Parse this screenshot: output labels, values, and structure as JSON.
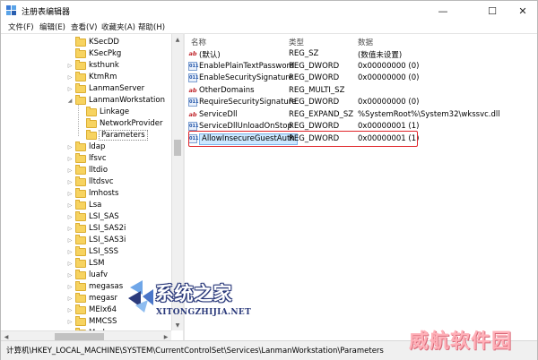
{
  "window": {
    "title": "注册表编辑器",
    "minimize_glyph": "—",
    "maximize_glyph": "☐",
    "close_glyph": "✕"
  },
  "menu": [
    "文件(F)",
    "编辑(E)",
    "查看(V)",
    "收藏夹(A)",
    "帮助(H)"
  ],
  "tree": {
    "items": [
      {
        "label": "KSecDD",
        "expander": "",
        "indent": 0
      },
      {
        "label": "KSecPkg",
        "expander": "",
        "indent": 0
      },
      {
        "label": "ksthunk",
        "expander": ">",
        "indent": 0
      },
      {
        "label": "KtmRm",
        "expander": ">",
        "indent": 0
      },
      {
        "label": "LanmanServer",
        "expander": ">",
        "indent": 0
      },
      {
        "label": "LanmanWorkstation",
        "expander": "v",
        "indent": 0
      },
      {
        "label": "Linkage",
        "expander": "",
        "indent": 1
      },
      {
        "label": "NetworkProvider",
        "expander": "",
        "indent": 1
      },
      {
        "label": "Parameters",
        "expander": "",
        "indent": 1,
        "selected": true
      },
      {
        "label": "ldap",
        "expander": ">",
        "indent": 0
      },
      {
        "label": "lfsvc",
        "expander": ">",
        "indent": 0
      },
      {
        "label": "lltdio",
        "expander": ">",
        "indent": 0
      },
      {
        "label": "lltdsvc",
        "expander": ">",
        "indent": 0
      },
      {
        "label": "lmhosts",
        "expander": ">",
        "indent": 0
      },
      {
        "label": "Lsa",
        "expander": ">",
        "indent": 0
      },
      {
        "label": "LSI_SAS",
        "expander": ">",
        "indent": 0
      },
      {
        "label": "LSI_SAS2i",
        "expander": ">",
        "indent": 0
      },
      {
        "label": "LSI_SAS3i",
        "expander": ">",
        "indent": 0
      },
      {
        "label": "LSI_SSS",
        "expander": ">",
        "indent": 0
      },
      {
        "label": "LSM",
        "expander": ">",
        "indent": 0
      },
      {
        "label": "luafv",
        "expander": ">",
        "indent": 0
      },
      {
        "label": "megasas",
        "expander": ">",
        "indent": 0
      },
      {
        "label": "megasr",
        "expander": ">",
        "indent": 0
      },
      {
        "label": "MEIx64",
        "expander": ">",
        "indent": 0
      },
      {
        "label": "MMCSS",
        "expander": ">",
        "indent": 0
      },
      {
        "label": "Modem",
        "expander": ">",
        "indent": 0
      }
    ]
  },
  "values": {
    "headers": {
      "name": "名称",
      "type": "类型",
      "data": "数据"
    },
    "rows": [
      {
        "icon": "ab",
        "name": "(默认)",
        "type": "REG_SZ",
        "data": "(数值未设置)"
      },
      {
        "icon": "bin",
        "name": "EnablePlainTextPassword",
        "type": "REG_DWORD",
        "data": "0x00000000 (0)"
      },
      {
        "icon": "bin",
        "name": "EnableSecuritySignature",
        "type": "REG_DWORD",
        "data": "0x00000000 (0)"
      },
      {
        "icon": "ab",
        "name": "OtherDomains",
        "type": "REG_MULTI_SZ",
        "data": ""
      },
      {
        "icon": "bin",
        "name": "RequireSecuritySignature",
        "type": "REG_DWORD",
        "data": "0x00000000 (0)"
      },
      {
        "icon": "ab",
        "name": "ServiceDll",
        "type": "REG_EXPAND_SZ",
        "data": "%SystemRoot%\\System32\\wkssvc.dll"
      },
      {
        "icon": "bin",
        "name": "ServiceDllUnloadOnStop",
        "type": "REG_DWORD",
        "data": "0x00000001 (1)"
      },
      {
        "icon": "bin",
        "name": "AllowInsecureGuestAuth",
        "type": "REG_DWORD",
        "data": "0x00000001 (1)",
        "highlight": true
      }
    ]
  },
  "icon_text": {
    "string": "ab",
    "binary": "011"
  },
  "status": {
    "path": "计算机\\HKEY_LOCAL_MACHINE\\SYSTEM\\CurrentControlSet\\Services\\LanmanWorkstation\\Parameters"
  },
  "watermarks": {
    "site_title": "系统之家",
    "site_url": "XITONGZHIJIA.NET",
    "corner_text": "威航软件园"
  },
  "colors": {
    "highlight_outline": "#e0262b",
    "selection_fill": "#cce8ff",
    "folder": "#f7d360"
  }
}
